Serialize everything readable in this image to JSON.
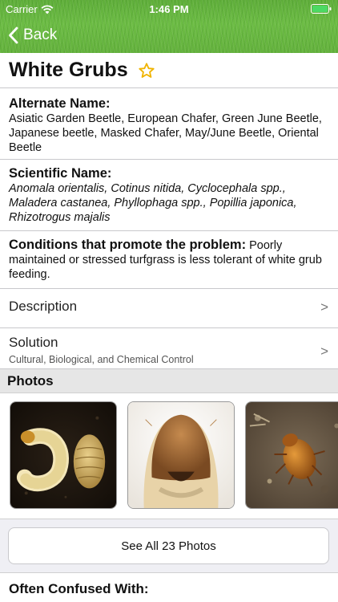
{
  "status_bar": {
    "carrier": "Carrier",
    "time": "1:46 PM",
    "wifi_icon": "wifi-icon",
    "battery_icon": "battery-full-icon"
  },
  "nav": {
    "back_label": "Back",
    "back_icon": "chevron-left-icon"
  },
  "pest": {
    "title": "White Grubs",
    "favorite_icon": "star-outline-icon",
    "accent_color": "#f0b400"
  },
  "alternate_name": {
    "heading": "Alternate Name:",
    "text": "Asiatic Garden Beetle, European Chafer, Green June Beetle, Japanese beetle, Masked Chafer, May/June Beetle, Oriental Beetle"
  },
  "scientific_name": {
    "heading": "Scientific Name:",
    "text": "Anomala orientalis, Cotinus nitida, Cyclocephala spp., Maladera castanea, Phyllophaga spp., Popillia japonica, Rhizotrogus majalis"
  },
  "conditions": {
    "heading": "Conditions that promote the problem:",
    "text": "Poorly maintained or stressed turfgrass is less tolerant of white grub feeding."
  },
  "rows": {
    "description": {
      "label": "Description",
      "chevron": ">"
    },
    "solution": {
      "label": "Solution",
      "subtitle": "Cultural, Biological, and Chemical Control",
      "chevron": ">"
    }
  },
  "photos": {
    "heading": "Photos",
    "see_all_label": "See All 23 Photos"
  },
  "confused": {
    "heading": "Often Confused With:"
  },
  "colors": {
    "header_green": "#64b23d",
    "separator": "#c8c8cc",
    "group_background": "#efeff4"
  }
}
